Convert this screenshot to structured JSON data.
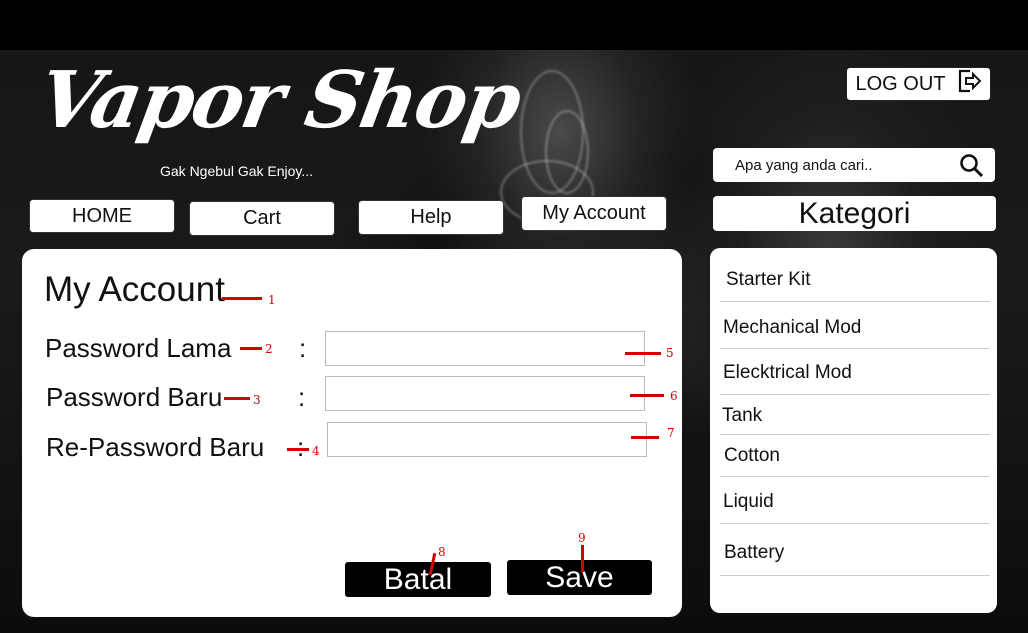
{
  "brand": {
    "logo": "Vapor Shop",
    "tagline": "Gak Ngebul Gak Enjoy..."
  },
  "header": {
    "logout_label": "LOG OUT",
    "logout_icon": "logout-icon",
    "search_placeholder": "Apa yang anda cari..",
    "search_icon": "search-icon"
  },
  "nav": {
    "items": [
      {
        "label": "HOME"
      },
      {
        "label": "Cart"
      },
      {
        "label": "Help"
      },
      {
        "label": "My Account"
      }
    ]
  },
  "account": {
    "title": "My Account",
    "fields": [
      {
        "label": "Password Lama",
        "colon": ":",
        "value": ""
      },
      {
        "label": "Password Baru",
        "colon": ":",
        "value": ""
      },
      {
        "label": "Re-Password Baru",
        "colon": ":",
        "value": ""
      }
    ],
    "cancel_label": "Batal",
    "save_label": "Save"
  },
  "kategori": {
    "title": "Kategori",
    "items": [
      {
        "label": "Starter Kit"
      },
      {
        "label": "Mechanical Mod"
      },
      {
        "label": "Elecktrical Mod"
      },
      {
        "label": "Tank"
      },
      {
        "label": "Cotton"
      },
      {
        "label": "Liquid"
      },
      {
        "label": "Battery"
      }
    ]
  },
  "annotations": {
    "color": "#d40000",
    "labels": [
      "1",
      "2",
      "3",
      "4",
      "5",
      "6",
      "7",
      "8",
      "9"
    ]
  }
}
